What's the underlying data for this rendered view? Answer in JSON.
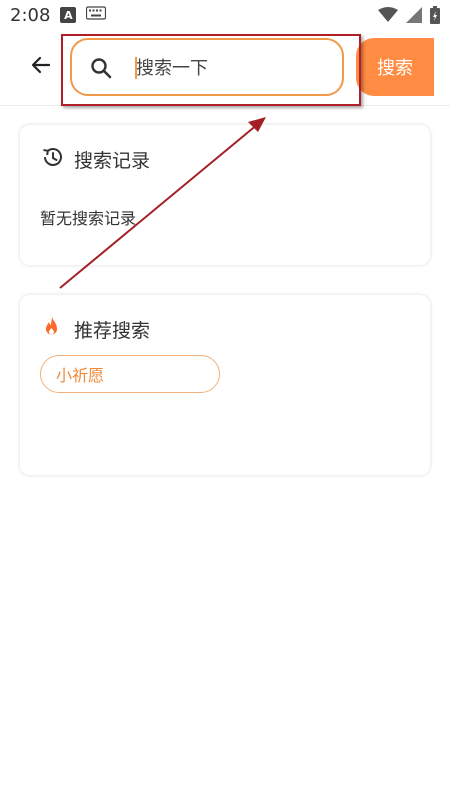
{
  "status_bar": {
    "time": "2:08",
    "badge_letter": "A",
    "icons": [
      "keyboard-icon",
      "wifi-icon",
      "signal-icon",
      "battery-icon"
    ]
  },
  "header": {
    "back_icon": "arrow-left-icon",
    "search_placeholder": "搜索一下",
    "search_value": "",
    "search_button_label": "搜索"
  },
  "history": {
    "title": "搜索记录",
    "empty_text": "暂无搜索记录",
    "icon": "history-icon"
  },
  "recommend": {
    "title": "推荐搜索",
    "icon": "flame-icon",
    "tags": [
      "小祈愿"
    ]
  },
  "colors": {
    "accent": "#ff8c42",
    "border_orange": "#f09a4a",
    "annotation_red": "#b0202a"
  }
}
